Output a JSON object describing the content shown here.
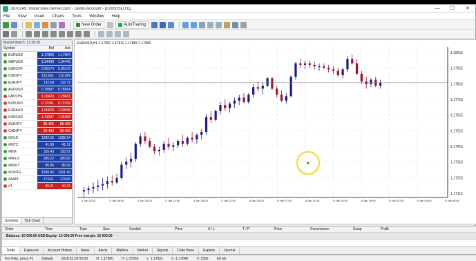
{
  "window": {
    "title": "3870249: InstaForex-Server.com - Demo Account - [EURUSD,H1]",
    "minimize": "—",
    "maximize": "☐",
    "close": "✕"
  },
  "menu": [
    "File",
    "View",
    "Insert",
    "Charts",
    "Tools",
    "Window",
    "Help"
  ],
  "toolbar": {
    "new_order": "New Order",
    "auto_trading": "AutoTrading"
  },
  "market_watch": {
    "title": "Market Watch: 12:28:58",
    "headers": {
      "symbol": "Symbol",
      "bid": "Bid",
      "ask": "Ask"
    },
    "rows": [
      {
        "symbol": "EURUSD",
        "bid": "1.17900",
        "ask": "1.17904",
        "color": "#1c3fa8"
      },
      {
        "symbol": "GBPUSD",
        "bid": "1.34438",
        "ask": "1.34445",
        "color": "#1c3fa8"
      },
      {
        "symbol": "USDCHF",
        "bid": "0.96174",
        "ask": "0.96178",
        "color": "#1c3fa8"
      },
      {
        "symbol": "USDJPY",
        "bid": "112.561",
        "ask": "112.569",
        "color": "#1c3fa8"
      },
      {
        "symbol": "EURJPY",
        "bid": "132.69",
        "ask": "132.72",
        "color": "#1c3fa8"
      },
      {
        "symbol": "AUDUSD",
        "bid": "0.78587",
        "ask": "0.78594",
        "color": "#1c3fa8"
      },
      {
        "symbol": "GBPCHF",
        "bid": "1.29420",
        "ask": "1.29431",
        "color": "#cc2020"
      },
      {
        "symbol": "NZDUSD",
        "bid": "0.72181",
        "ask": "0.72192",
        "color": "#cc2020"
      },
      {
        "symbol": "EURAUD",
        "bid": "1.50029",
        "ask": "1.50038",
        "color": "#cc2020"
      },
      {
        "symbol": "USDCAD",
        "bid": "1.24397",
        "ask": "1.24405",
        "color": "#cc2020"
      },
      {
        "symbol": "AUDJPY",
        "bid": "88.455",
        "ask": "88.468",
        "color": "#cc2020"
      },
      {
        "symbol": "CADJPY",
        "bid": "90.480",
        "ask": "90.492",
        "color": "#cc2020"
      },
      {
        "symbol": "GOLD",
        "bid": "1282.55",
        "ask": "1282.94",
        "color": "#1c3fa8"
      },
      {
        "symbol": "#INTC",
        "bid": "41.09",
        "ask": "41.12",
        "color": "#1c3fa8"
      },
      {
        "symbol": "#IBM",
        "bid": "155.43",
        "ask": "155.51",
        "color": "#1c3fa8"
      },
      {
        "symbol": "#NFLX",
        "bid": "285.22",
        "ask": "285.60",
        "color": "#1c3fa8"
      },
      {
        "symbol": "#MSFT",
        "bid": "85.95",
        "ask": "85.99",
        "color": "#1c3fa8"
      },
      {
        "symbol": "#GOOG",
        "bid": "1030.42",
        "ask": "1031.40",
        "color": "#1c3fa8"
      },
      {
        "symbol": "#AAPL",
        "bid": "174.61",
        "ask": "174.69",
        "color": "#1c3fa8"
      },
      {
        "symbol": "#T",
        "bid": "40.21",
        "ask": "40.23",
        "color": "#cc2020"
      }
    ],
    "tabs": [
      "Symbols",
      "Tick Chart"
    ]
  },
  "chart": {
    "label": "EURUSD,H1 1.17902 1.17911 1.17883 1.17900",
    "y_ticks": [
      "1.18015",
      "1.17915",
      "1.17815",
      "1.17715",
      "1.17615",
      "1.17515",
      "1.17415",
      "1.17315",
      "1.17215",
      "1.17115"
    ],
    "x_ticks": [
      "5 Jan 2018",
      "5 Jan 06:00",
      "5 Jan 10:00",
      "5 Jan 14:00",
      "5 Jan 18:00",
      "5 Jan 22:00",
      "8 Jan 03:00",
      "8 Jan 07:00",
      "8 Jan 11:00",
      "8 Jan 15:00",
      "8 Jan 19:00",
      "8 Jan 23:00",
      "9 Jan 04:00",
      "9 Jan 08:00"
    ]
  },
  "chart_data": {
    "type": "candlestick",
    "title": "EURUSD,H1",
    "ylim": [
      1.1706,
      1.1807
    ],
    "bull_color": "#1a1a8c",
    "bear_color": "#a01020",
    "ohlc": [
      [
        1.171,
        1.1713,
        1.1706,
        1.1711
      ],
      [
        1.1711,
        1.1714,
        1.1708,
        1.1712
      ],
      [
        1.1712,
        1.1716,
        1.1709,
        1.1713
      ],
      [
        1.1713,
        1.1718,
        1.171,
        1.1714
      ],
      [
        1.1714,
        1.1719,
        1.1711,
        1.1715
      ],
      [
        1.1715,
        1.172,
        1.1712,
        1.1717
      ],
      [
        1.1717,
        1.1721,
        1.1714,
        1.1716
      ],
      [
        1.1716,
        1.1722,
        1.1715,
        1.1719
      ],
      [
        1.1719,
        1.173,
        1.1718,
        1.1728
      ],
      [
        1.1728,
        1.1733,
        1.1725,
        1.173
      ],
      [
        1.173,
        1.1736,
        1.1726,
        1.1732
      ],
      [
        1.1732,
        1.1743,
        1.173,
        1.1742
      ],
      [
        1.1742,
        1.1749,
        1.174,
        1.1747
      ],
      [
        1.1747,
        1.175,
        1.1742,
        1.1744
      ],
      [
        1.1744,
        1.1746,
        1.1739,
        1.174
      ],
      [
        1.174,
        1.1742,
        1.1735,
        1.1737
      ],
      [
        1.1737,
        1.174,
        1.1734,
        1.1738
      ],
      [
        1.1738,
        1.1744,
        1.1736,
        1.1742
      ],
      [
        1.1742,
        1.1746,
        1.1738,
        1.174
      ],
      [
        1.174,
        1.1743,
        1.1737,
        1.1741
      ],
      [
        1.1741,
        1.1745,
        1.1739,
        1.1744
      ],
      [
        1.1744,
        1.1748,
        1.174,
        1.1742
      ],
      [
        1.1742,
        1.1747,
        1.1741,
        1.1746
      ],
      [
        1.1746,
        1.175,
        1.1743,
        1.1745
      ],
      [
        1.1745,
        1.1749,
        1.1742,
        1.1748
      ],
      [
        1.1748,
        1.1752,
        1.1745,
        1.175
      ],
      [
        1.175,
        1.1762,
        1.1748,
        1.176
      ],
      [
        1.176,
        1.1764,
        1.1756,
        1.1758
      ],
      [
        1.1758,
        1.1765,
        1.1757,
        1.1764
      ],
      [
        1.1764,
        1.177,
        1.1762,
        1.1768
      ],
      [
        1.1768,
        1.1772,
        1.1764,
        1.1766
      ],
      [
        1.1766,
        1.177,
        1.1763,
        1.1769
      ],
      [
        1.1769,
        1.1773,
        1.1766,
        1.1771
      ],
      [
        1.1771,
        1.1775,
        1.1768,
        1.1773
      ],
      [
        1.1773,
        1.1776,
        1.1769,
        1.177
      ],
      [
        1.177,
        1.1776,
        1.1769,
        1.1775
      ],
      [
        1.1775,
        1.1782,
        1.1773,
        1.178
      ],
      [
        1.178,
        1.1784,
        1.1777,
        1.1779
      ],
      [
        1.1779,
        1.1783,
        1.1775,
        1.1781
      ],
      [
        1.1781,
        1.1787,
        1.178,
        1.1786
      ],
      [
        1.1786,
        1.1787,
        1.1778,
        1.1779
      ],
      [
        1.1779,
        1.1781,
        1.1773,
        1.1775
      ],
      [
        1.1775,
        1.1778,
        1.177,
        1.1771
      ],
      [
        1.1771,
        1.1776,
        1.1769,
        1.1774
      ],
      [
        1.1774,
        1.1788,
        1.1773,
        1.1787
      ],
      [
        1.1787,
        1.1797,
        1.1785,
        1.1796
      ],
      [
        1.1796,
        1.1799,
        1.1793,
        1.1795
      ],
      [
        1.1795,
        1.1798,
        1.1792,
        1.1796
      ],
      [
        1.1796,
        1.1798,
        1.1793,
        1.1795
      ],
      [
        1.1795,
        1.1797,
        1.1792,
        1.1794
      ],
      [
        1.1794,
        1.1796,
        1.1791,
        1.1794
      ],
      [
        1.1794,
        1.1796,
        1.1792,
        1.1793
      ],
      [
        1.1793,
        1.1795,
        1.179,
        1.1792
      ],
      [
        1.1792,
        1.1794,
        1.1789,
        1.1791
      ],
      [
        1.1791,
        1.1793,
        1.1787,
        1.1788
      ],
      [
        1.1788,
        1.1793,
        1.1786,
        1.1792
      ],
      [
        1.1792,
        1.1801,
        1.179,
        1.1799
      ],
      [
        1.1799,
        1.1802,
        1.1795,
        1.1796
      ],
      [
        1.1796,
        1.1799,
        1.1788,
        1.1789
      ],
      [
        1.1789,
        1.1791,
        1.1782,
        1.1784
      ],
      [
        1.1784,
        1.1787,
        1.1779,
        1.1782
      ],
      [
        1.1782,
        1.1786,
        1.178,
        1.1785
      ],
      [
        1.1785,
        1.1787,
        1.178,
        1.1781
      ],
      [
        1.1781,
        1.1785,
        1.1779,
        1.1783
      ]
    ]
  },
  "terminal": {
    "columns": [
      "Order",
      "Time",
      "Type",
      "Size",
      "Symbol",
      "Price",
      "S / L",
      "T / P",
      "Price",
      "Commission",
      "Swap",
      "Profit"
    ],
    "balance_line": "Balance: 10 000.00 USD  Equity: 10 000.00  Free margin: 10 000.00",
    "tabs": [
      "Trade",
      "Exposure",
      "Account History",
      "News",
      "Alerts",
      "Mailbox",
      "Market",
      "Signals",
      "Code Base",
      "Experts",
      "Journal"
    ],
    "side_label": "Terminal"
  },
  "statusbar": [
    "For Help, press F1",
    "Default",
    "2018.01.09 05:00",
    "O: 1.17900",
    "H: 1.17953",
    "L: 1.17821",
    "C: 1.17842",
    "V: 2356",
    "9/1 kb"
  ]
}
